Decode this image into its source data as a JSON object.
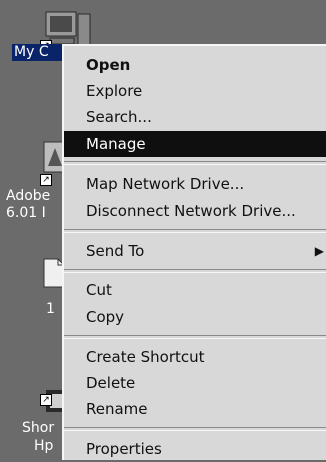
{
  "desktop": {
    "icons": [
      {
        "label": "My C"
      },
      {
        "label_line1": "Adobe",
        "label_line2": "6.01 I"
      },
      {
        "label": "1"
      },
      {
        "label_line1": "Shor",
        "label_line2": "Hp"
      }
    ]
  },
  "menu": {
    "items": [
      {
        "label": "Open",
        "bold": true
      },
      {
        "label": "Explore"
      },
      {
        "label": "Search..."
      },
      {
        "label": "Manage",
        "selected": true
      },
      {
        "label": "Map Network Drive..."
      },
      {
        "label": "Disconnect Network Drive..."
      },
      {
        "label": "Send To",
        "submenu": true
      },
      {
        "label": "Cut"
      },
      {
        "label": "Copy"
      },
      {
        "label": "Create Shortcut"
      },
      {
        "label": "Delete"
      },
      {
        "label": "Rename"
      },
      {
        "label": "Properties"
      }
    ]
  },
  "colors": {
    "desktop": "#6b6b6b",
    "menu_background": "#d8d8d8",
    "selection": "#0f0f0f"
  },
  "icons": {
    "submenu_arrow": "triangle-right-icon"
  }
}
